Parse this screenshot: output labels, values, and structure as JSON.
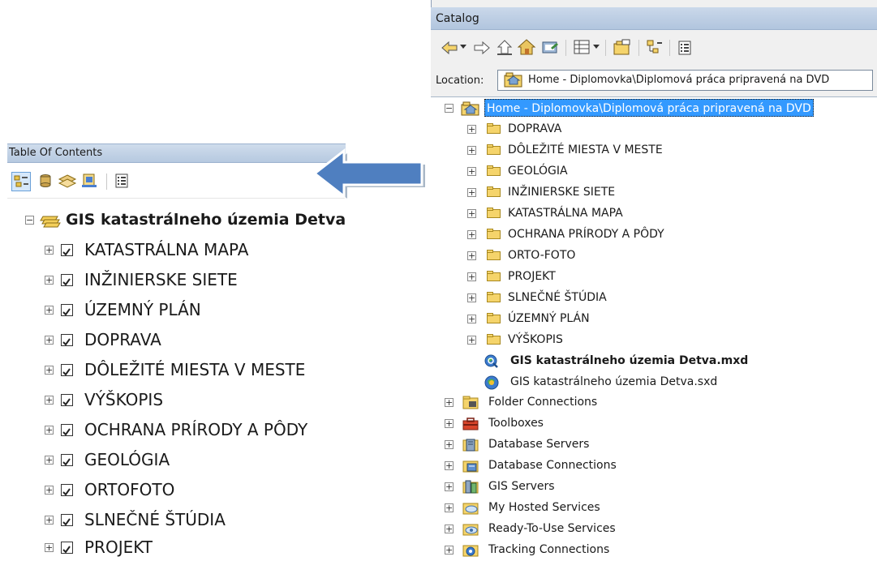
{
  "toc": {
    "title": "Table Of Contents",
    "root_label": "GIS katastrálneho územia Detva",
    "layers": [
      {
        "label": "KATASTRÁLNA MAPA",
        "checked": true
      },
      {
        "label": "INŽINIERSKE SIETE",
        "checked": true
      },
      {
        "label": "ÚZEMNÝ PLÁN",
        "checked": true
      },
      {
        "label": "DOPRAVA",
        "checked": true
      },
      {
        "label": "DÔLEŽITÉ MIESTA V MESTE",
        "checked": true
      },
      {
        "label": "VÝŠKOPIS",
        "checked": true
      },
      {
        "label": "OCHRANA PRÍRODY A PÔDY",
        "checked": true
      },
      {
        "label": "GEOLÓGIA",
        "checked": true
      },
      {
        "label": "ORTOFOTO",
        "checked": true
      },
      {
        "label": "SLNEČNÉ ŠTÚDIA",
        "checked": true
      },
      {
        "label": "PROJEKT",
        "checked": true
      }
    ]
  },
  "catalog": {
    "title": "Catalog",
    "location_label": "Location:",
    "location_value": "Home - Diplomovka\\Diplomová práca pripravená na DVD",
    "root_label": "Home - Diplomovka\\Diplomová práca pripravená na DVD",
    "folders": [
      {
        "label": "DOPRAVA"
      },
      {
        "label": "DÔLEŽITÉ MIESTA V MESTE"
      },
      {
        "label": "GEOLÓGIA"
      },
      {
        "label": "INŽINIERSKE SIETE"
      },
      {
        "label": "KATASTRÁLNA MAPA"
      },
      {
        "label": "OCHRANA PRÍRODY A PÔDY"
      },
      {
        "label": "ORTO-FOTO"
      },
      {
        "label": "PROJEKT"
      },
      {
        "label": "SLNEČNÉ ŠTÚDIA"
      },
      {
        "label": "ÚZEMNÝ PLÁN"
      },
      {
        "label": "VÝŠKOPIS"
      }
    ],
    "files": [
      {
        "label": "GIS katastrálneho územia Detva.mxd",
        "icon": "mxd-file-icon",
        "bold": true
      },
      {
        "label": "GIS katastrálneho územia Detva.sxd",
        "icon": "sxd-file-icon",
        "bold": false
      }
    ],
    "connections": [
      {
        "label": "Folder Connections",
        "icon": "folder-connections-icon"
      },
      {
        "label": "Toolboxes",
        "icon": "toolboxes-icon"
      },
      {
        "label": "Database Servers",
        "icon": "database-servers-icon"
      },
      {
        "label": "Database Connections",
        "icon": "database-connections-icon"
      },
      {
        "label": "GIS Servers",
        "icon": "gis-servers-icon"
      },
      {
        "label": "My Hosted Services",
        "icon": "hosted-services-icon"
      },
      {
        "label": "Ready-To-Use Services",
        "icon": "ready-to-use-services-icon"
      },
      {
        "label": "Tracking Connections",
        "icon": "tracking-connections-icon"
      }
    ]
  },
  "colors": {
    "selection": "#3399ff",
    "folder_yellow": "#f5d46b",
    "arrow_blue": "#4f7fc0"
  }
}
